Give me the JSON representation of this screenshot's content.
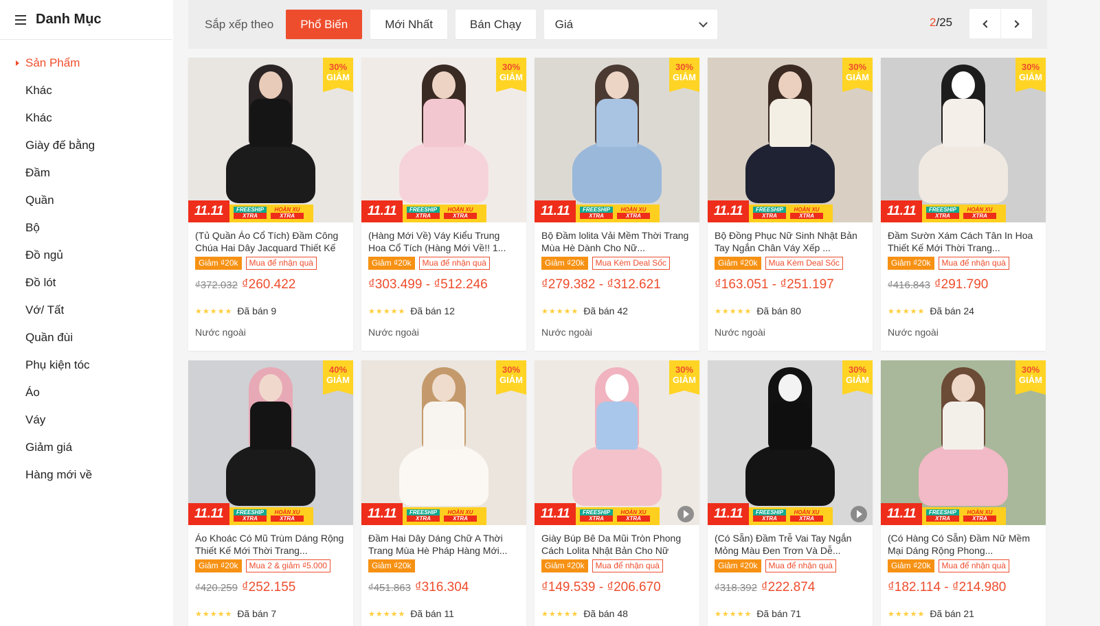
{
  "sidebar": {
    "title": "Danh Mục",
    "items": [
      {
        "label": "Sản Phẩm",
        "active": true
      },
      {
        "label": "Khác"
      },
      {
        "label": "Khác"
      },
      {
        "label": "Giày đế bằng"
      },
      {
        "label": "Đầm"
      },
      {
        "label": "Quần"
      },
      {
        "label": "Bộ"
      },
      {
        "label": "Đồ ngủ"
      },
      {
        "label": "Đồ lót"
      },
      {
        "label": "Vớ/ Tất"
      },
      {
        "label": "Quần đùi"
      },
      {
        "label": "Phụ kiện tóc"
      },
      {
        "label": "Áo"
      },
      {
        "label": "Váy"
      },
      {
        "label": "Giảm giá"
      },
      {
        "label": "Hàng mới về"
      }
    ]
  },
  "sortbar": {
    "label": "Sắp xếp theo",
    "options": [
      "Phổ Biến",
      "Mới Nhất",
      "Bán Chạy"
    ],
    "active": "Phổ Biến",
    "price_label": "Giá",
    "page_current": "2",
    "page_total": "/25"
  },
  "colors": {
    "accent": "#ee4d2d",
    "badge": "#f69113",
    "discount_bg": "#ffd424"
  },
  "banner": {
    "event": "11.11",
    "freeship_top": "FREESHIP",
    "freeship_bot": "XTRA",
    "hoanxu_top": "HOÀN XU",
    "hoanxu_bot": "XTRA"
  },
  "products": [
    {
      "name": "(Tủ Quần Áo Cổ Tích) Đầm Công Chúa Hai Dây Jacquard Thiết Kế",
      "discount_pct": "30%",
      "discount_word": "GIẢM",
      "badge1": "Giảm ₫20k",
      "badge2": "Mua để nhận quà",
      "old_price": "₫372.032",
      "price": "₫260.422",
      "sold": "Đã bán 9",
      "origin": "Nước ngoài",
      "bg": "#e9e6e2",
      "hair": "#2a2424",
      "body": "#151515",
      "skirt": "#1b1b1b",
      "head": "#e8cbb8",
      "video": false
    },
    {
      "name": "(Hàng Mới Về) Váy Kiểu Trung Hoa Cổ Tích (Hàng Mới Về!! 1...",
      "discount_pct": "30%",
      "discount_word": "GIẢM",
      "badge1": "Giảm ₫20k",
      "badge2": "Mua để nhận quà",
      "old_price": "",
      "price": "₫303.499 - ₫512.246",
      "sold": "Đã bán 12",
      "origin": "Nước ngoài",
      "bg": "#f1ebe8",
      "hair": "#3a2a24",
      "body": "#f3c7cf",
      "skirt": "#f6d3da",
      "head": "#edd3c3",
      "video": false
    },
    {
      "name": "Bộ Đầm lolita Vải Mềm Thời Trang Mùa Hè Dành Cho Nữ...",
      "discount_pct": "30%",
      "discount_word": "GIẢM",
      "badge1": "Giảm ₫20k",
      "badge2": "Mua Kèm Deal Sốc",
      "old_price": "",
      "price": "₫279.382 - ₫312.621",
      "sold": "Đã bán 42",
      "origin": "Nước ngoài",
      "bg": "#dcd9d3",
      "hair": "#4a3a32",
      "body": "#a9c4e2",
      "skirt": "#9ab8da",
      "head": "#edd5c6",
      "video": false
    },
    {
      "name": "Bộ Đồng Phục Nữ Sinh Nhật Bản Tay Ngắn Chân Váy Xếp ...",
      "discount_pct": "30%",
      "discount_word": "GIẢM",
      "badge1": "Giảm ₫20k",
      "badge2": "Mua Kèm Deal Sốc",
      "old_price": "",
      "price": "₫163.051 - ₫251.197",
      "sold": "Đã bán 80",
      "origin": "Nước ngoài",
      "bg": "#d9cfc3",
      "hair": "#3b2a22",
      "body": "#f3efe4",
      "skirt": "#1f2233",
      "head": "#ecd0bf",
      "video": false
    },
    {
      "name": "Đầm Sườn Xám Cách Tân In Hoa Thiết Kế Mới Thời Trang...",
      "discount_pct": "30%",
      "discount_word": "GIẢM",
      "badge1": "Giảm ₫20k",
      "badge2": "Mua để nhận quà",
      "old_price": "₫416.843",
      "price": "₫291.790",
      "sold": "Đã bán 24",
      "origin": "Nước ngoài",
      "bg": "#cfcfcf",
      "hair": "#1d1d1d",
      "body": "#f4efe9",
      "skirt": "#efe9e2",
      "head": "#ffffff",
      "video": false
    },
    {
      "name": "Áo Khoác Có Mũ Trùm Dáng Rộng Thiết Kế Mới Thời Trang...",
      "discount_pct": "40%",
      "discount_word": "GIẢM",
      "badge1": "Giảm ₫20k",
      "badge2": "Mua 2 & giảm ₫5.000",
      "old_price": "₫420.259",
      "price": "₫252.155",
      "sold": "Đã bán 7",
      "origin": "",
      "bg": "#cfd1d4",
      "hair": "#e8a9b6",
      "body": "#141414",
      "skirt": "#1a1a1a",
      "head": "#f0d8cc",
      "video": false
    },
    {
      "name": "Đầm Hai Dây Dáng Chữ A Thời Trang Mùa Hè Pháp Hàng Mới...",
      "discount_pct": "30%",
      "discount_word": "GIẢM",
      "badge1": "Giảm ₫20k",
      "badge2": "",
      "old_price": "₫451.863",
      "price": "₫316.304",
      "sold": "Đã bán 11",
      "origin": "",
      "bg": "#ebe5dd",
      "hair": "#c49a6c",
      "body": "#f8f5f0",
      "skirt": "#fbf8f3",
      "head": "#efdccd",
      "video": false
    },
    {
      "name": "Giày Búp Bê Da Mũi Tròn Phong Cách Lolita Nhật Bản Cho Nữ",
      "discount_pct": "30%",
      "discount_word": "GIẢM",
      "badge1": "Giảm ₫20k",
      "badge2": "Mua để nhận quà",
      "old_price": "",
      "price": "₫149.539 - ₫206.670",
      "sold": "Đã bán 48",
      "origin": "",
      "bg": "#efe9e3",
      "hair": "#f0b3bf",
      "body": "#a9c7ea",
      "skirt": "#f3c2cb",
      "head": "#ffffff",
      "video": true
    },
    {
      "name": "(Có Sẵn) Đầm Trễ Vai Tay Ngắn Mỏng Màu Đen Trơn Và Dễ...",
      "discount_pct": "30%",
      "discount_word": "GIẢM",
      "badge1": "Giảm ₫20k",
      "badge2": "Mua để nhận quà",
      "old_price": "₫318.392",
      "price": "₫222.874",
      "sold": "Đã bán 71",
      "origin": "",
      "bg": "#d8d8d8",
      "hair": "#111111",
      "body": "#0f0f0f",
      "skirt": "#141414",
      "head": "#f3f3f3",
      "video": true
    },
    {
      "name": "(Có Hàng Có Sẵn) Đầm Nữ Mềm Mại Dáng Rộng Phong...",
      "discount_pct": "30%",
      "discount_word": "GIẢM",
      "badge1": "Giảm ₫20k",
      "badge2": "Mua để nhận quà",
      "old_price": "",
      "price": "₫182.114 - ₫214.980",
      "sold": "Đã bán 21",
      "origin": "",
      "bg": "#a9b89a",
      "hair": "#6b4a36",
      "body": "#f3f0ea",
      "skirt": "#f2b9c6",
      "head": "#efd7c7",
      "video": false
    }
  ]
}
